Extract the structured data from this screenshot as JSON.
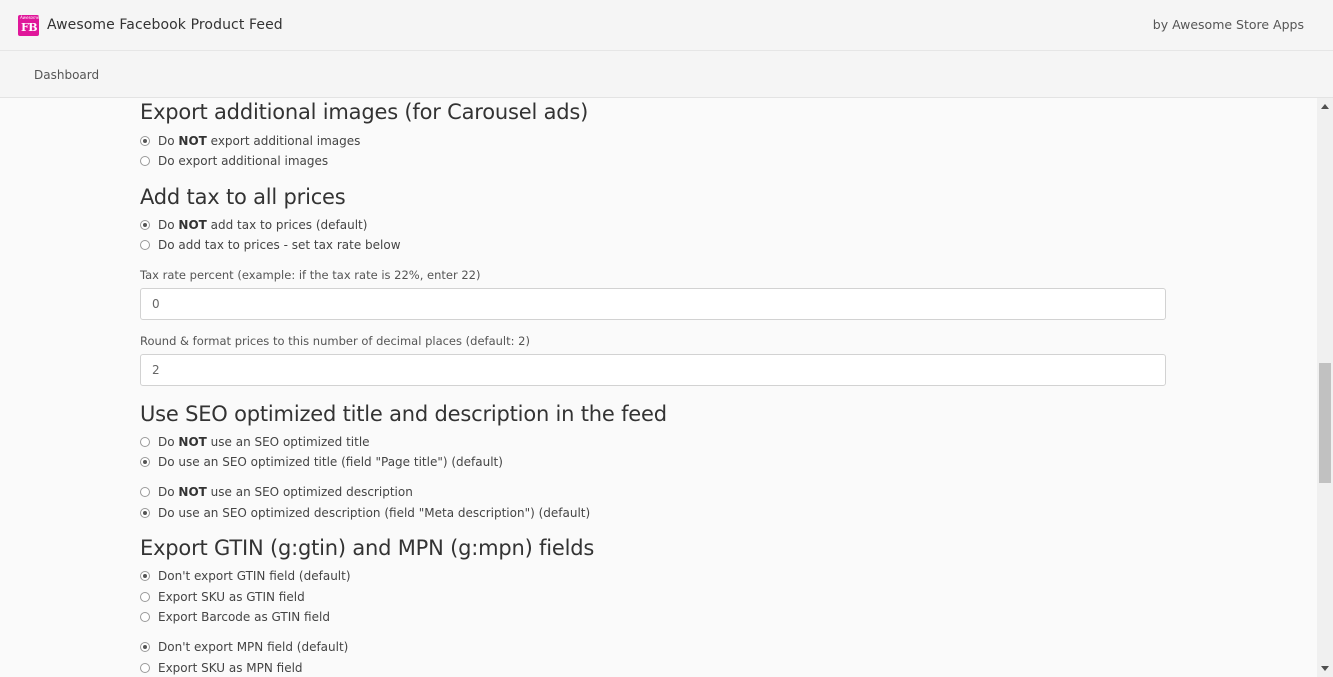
{
  "header": {
    "logo_tiny": "Awesome",
    "logo_letters": "FB",
    "title": "Awesome Facebook Product Feed",
    "by_text": "by Awesome Store Apps"
  },
  "nav": {
    "dashboard": "Dashboard"
  },
  "sections": {
    "images": {
      "heading": "Export additional images (for Carousel ads)",
      "opt1": {
        "pre": "Do ",
        "bold": "NOT",
        "post": " export additional images",
        "checked": true
      },
      "opt2": {
        "text": "Do export additional images",
        "checked": false
      }
    },
    "tax": {
      "heading": "Add tax to all prices",
      "opt1": {
        "pre": "Do ",
        "bold": "NOT",
        "post": " add tax to prices (default)",
        "checked": true
      },
      "opt2": {
        "text": "Do add tax to prices - set tax rate below",
        "checked": false
      },
      "rate_label": "Tax rate percent (example: if the tax rate is 22%, enter 22)",
      "rate_value": "0",
      "decimals_label": "Round & format prices to this number of decimal places (default: 2)",
      "decimals_value": "2"
    },
    "seo": {
      "heading": "Use SEO optimized title and description in the feed",
      "title_opt1": {
        "pre": "Do ",
        "bold": "NOT",
        "post": " use an SEO optimized title",
        "checked": false
      },
      "title_opt2": {
        "text": "Do use an SEO optimized title (field \"Page title\") (default)",
        "checked": true
      },
      "desc_opt1": {
        "pre": "Do ",
        "bold": "NOT",
        "post": " use an SEO optimized description",
        "checked": false
      },
      "desc_opt2": {
        "text": "Do use an SEO optimized description (field \"Meta description\") (default)",
        "checked": true
      }
    },
    "gtin": {
      "heading": "Export GTIN (g:gtin) and MPN (g:mpn) fields",
      "gtin_opt1": {
        "text": "Don't export GTIN field (default)",
        "checked": true
      },
      "gtin_opt2": {
        "text": "Export SKU as GTIN field",
        "checked": false
      },
      "gtin_opt3": {
        "text": "Export Barcode as GTIN field",
        "checked": false
      },
      "mpn_opt1": {
        "text": "Don't export MPN field (default)",
        "checked": true
      },
      "mpn_opt2": {
        "text": "Export SKU as MPN field",
        "checked": false
      }
    }
  },
  "colors": {
    "brand": "#e0179a",
    "page_bg": "#fafafa",
    "header_bg": "#f5f5f5"
  }
}
